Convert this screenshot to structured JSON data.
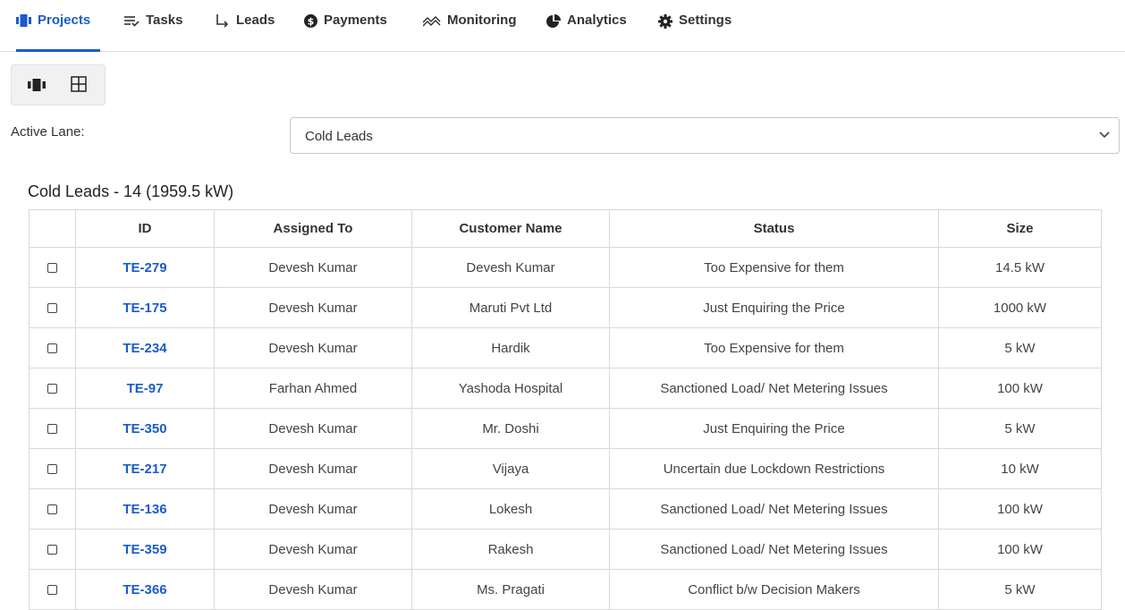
{
  "nav": {
    "tabs": [
      {
        "label": "Projects",
        "icon": "projects-icon",
        "active": true
      },
      {
        "label": "Tasks",
        "icon": "tasks-icon",
        "active": false
      },
      {
        "label": "Leads",
        "icon": "leads-icon",
        "active": false
      },
      {
        "label": "Payments",
        "icon": "payments-icon",
        "active": false
      },
      {
        "label": "Monitoring",
        "icon": "monitoring-icon",
        "active": false
      },
      {
        "label": "Analytics",
        "icon": "analytics-icon",
        "active": false
      },
      {
        "label": "Settings",
        "icon": "settings-icon",
        "active": false
      }
    ]
  },
  "view_toggle": {
    "options": [
      "kanban-view-icon",
      "grid-view-icon"
    ]
  },
  "lane": {
    "label": "Active Lane:",
    "selected": "Cold Leads"
  },
  "table": {
    "title": "Cold Leads - 14 (1959.5 kW)",
    "columns": [
      "",
      "ID",
      "Assigned To",
      "Customer Name",
      "Status",
      "Size"
    ],
    "rows": [
      {
        "id": "TE-279",
        "assigned_to": "Devesh Kumar",
        "customer": "Devesh Kumar",
        "status": "Too Expensive for them",
        "size": "14.5 kW"
      },
      {
        "id": "TE-175",
        "assigned_to": "Devesh Kumar",
        "customer": "Maruti Pvt Ltd",
        "status": "Just Enquiring the Price",
        "size": "1000 kW"
      },
      {
        "id": "TE-234",
        "assigned_to": "Devesh Kumar",
        "customer": "Hardik",
        "status": "Too Expensive for them",
        "size": "5 kW"
      },
      {
        "id": "TE-97",
        "assigned_to": "Farhan Ahmed",
        "customer": "Yashoda Hospital",
        "status": "Sanctioned Load/ Net Metering Issues",
        "size": "100 kW"
      },
      {
        "id": "TE-350",
        "assigned_to": "Devesh Kumar",
        "customer": "Mr. Doshi",
        "status": "Just Enquiring the Price",
        "size": "5 kW"
      },
      {
        "id": "TE-217",
        "assigned_to": "Devesh Kumar",
        "customer": "Vijaya",
        "status": "Uncertain due Lockdown Restrictions",
        "size": "10 kW"
      },
      {
        "id": "TE-136",
        "assigned_to": "Devesh Kumar",
        "customer": "Lokesh",
        "status": "Sanctioned Load/ Net Metering Issues",
        "size": "100 kW"
      },
      {
        "id": "TE-359",
        "assigned_to": "Devesh Kumar",
        "customer": "Rakesh",
        "status": "Sanctioned Load/ Net Metering Issues",
        "size": "100 kW"
      },
      {
        "id": "TE-366",
        "assigned_to": "Devesh Kumar",
        "customer": "Ms. Pragati",
        "status": "Conflict b/w Decision Makers",
        "size": "5 kW"
      }
    ]
  },
  "colors": {
    "accent": "#1a5bcc",
    "border": "#d9d9d9",
    "text": "#333333"
  }
}
